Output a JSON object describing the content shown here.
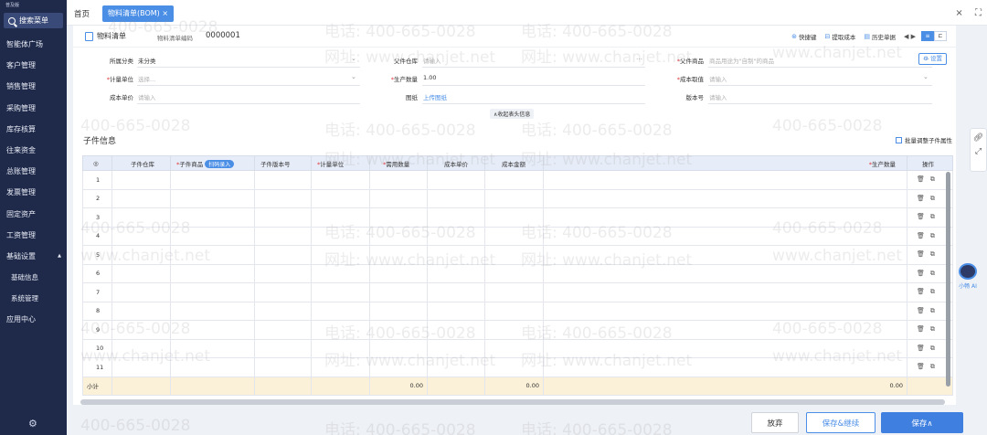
{
  "sidebar": {
    "brand": "普及版",
    "search": "搜索菜单",
    "items": [
      {
        "label": "智能体广场"
      },
      {
        "label": "客户管理"
      },
      {
        "label": "销售管理"
      },
      {
        "label": "采购管理"
      },
      {
        "label": "库存核算"
      },
      {
        "label": "往来资金"
      },
      {
        "label": "总账管理"
      },
      {
        "label": "发票管理"
      },
      {
        "label": "固定资产"
      },
      {
        "label": "工资管理"
      },
      {
        "label": "基础设置"
      },
      {
        "label": "基础信息"
      },
      {
        "label": "系统管理"
      },
      {
        "label": "应用中心"
      }
    ]
  },
  "tabs": {
    "home": "首页",
    "active": "物料清单(BOM)",
    "close": "×"
  },
  "window": {
    "close": "×",
    "max": "⛶"
  },
  "toolbar": {
    "doc_title": "物料清单",
    "doc_code_label": "物料清单编码",
    "doc_code": "0000001",
    "shortcut": "快捷键",
    "fetch_cost": "提取成本",
    "history": "历史单据"
  },
  "form": {
    "class_label": "所属分类",
    "class_value": "未分类",
    "parent_wh_label": "父件仓库",
    "parent_wh_ph": "请输入",
    "parent_item_label": "父件商品",
    "parent_item_ph": "商品用途为\"自制\"的商品",
    "unit_label": "计量单位",
    "unit_ph": "选择...",
    "qty_label": "生产数量",
    "qty_value": "1.00",
    "cost_label": "成本取值",
    "cost_ph": "请输入",
    "unit_cost_label": "成本单价",
    "unit_cost_ph": "请输入",
    "drawing_label": "图纸",
    "drawing_link": "上传图纸",
    "version_label": "版本号",
    "version_ph": "请输入",
    "settings": "设置",
    "collapse": "∧收起表头信息"
  },
  "section": {
    "title": "子件信息",
    "batch": "批量调整子件属性"
  },
  "grid": {
    "headers": {
      "sel": "◎",
      "wh": "子件仓库",
      "item": "子件商品",
      "scan": "扫码录入",
      "ver": "子件版本号",
      "unit": "计量单位",
      "qty": "需用数量",
      "price": "成本单价",
      "amount": "成本金额",
      "prod": "生产数量",
      "ops": "操作"
    },
    "rows": [
      "1",
      "2",
      "3",
      "4",
      "5",
      "6",
      "7",
      "8",
      "9",
      "10",
      "11"
    ],
    "footer": {
      "label": "小计",
      "qty": "0.00",
      "amount": "0.00",
      "prod": "0.00"
    }
  },
  "buttons": {
    "cancel": "放弃",
    "save_continue": "保存&继续",
    "save": "保存∧"
  },
  "ai": {
    "label": "小畅 AI"
  },
  "watermark": {
    "phone": "电话: 400-665-0028",
    "site": "网址: www.chanjet.net",
    "phone_short": "400-665-0028",
    "site_short": "www.chanjet.net"
  },
  "colors": {
    "primary": "#4a8ee6",
    "sidebar": "#1f2a4b",
    "required": "#e0363a"
  }
}
